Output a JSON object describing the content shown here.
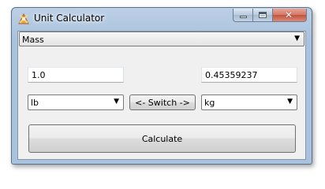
{
  "window": {
    "title": "Unit Calculator",
    "icon": "calculator-app-icon"
  },
  "caption_buttons": {
    "minimize_icon": "minimize-icon",
    "maximize_icon": "maximize-icon",
    "close_icon": "close-icon",
    "close_glyph": "✕"
  },
  "category_select": {
    "value": "Mass",
    "arrow": "▼"
  },
  "input_value": "1.0",
  "output_value": "0.45359237",
  "from_unit": {
    "value": "lb",
    "arrow": "▼"
  },
  "to_unit": {
    "value": "kg",
    "arrow": "▼"
  },
  "switch_button": {
    "label": "<- Switch ->"
  },
  "calculate_button": {
    "label": "Calculate"
  },
  "colors": {
    "frame": "#a9c2dd",
    "client": "#f0f0f0",
    "close_button": "#c4513b"
  }
}
